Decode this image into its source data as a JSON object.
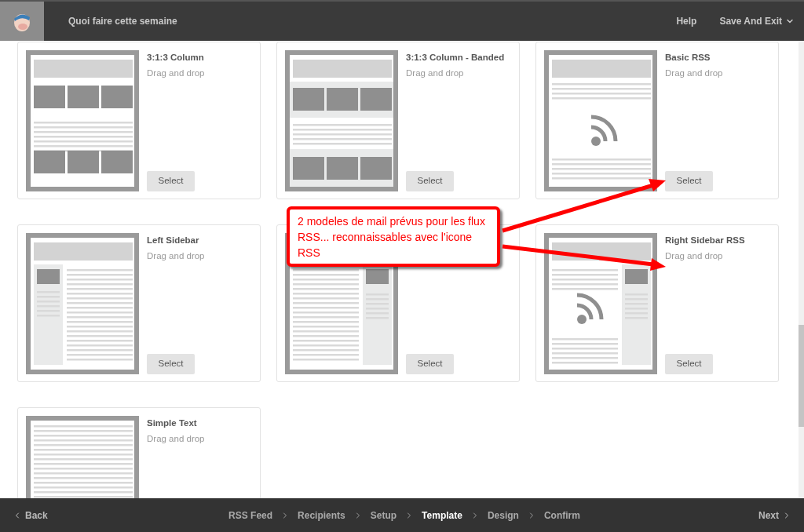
{
  "header": {
    "title": "Quoi faire cette semaine",
    "links": [
      {
        "label": "Help",
        "kind": "link"
      },
      {
        "label": "Save And Exit",
        "kind": "menu"
      }
    ]
  },
  "templates": [
    {
      "kind": "three-column",
      "title": "3:1:3 Column",
      "subtitle": "Drag and drop",
      "button": "Select"
    },
    {
      "kind": "three-column-banded",
      "title": "3:1:3 Column - Banded",
      "subtitle": "Drag and drop",
      "button": "Select"
    },
    {
      "kind": "basic-rss",
      "title": "Basic RSS",
      "subtitle": "Drag and drop",
      "button": "Select"
    },
    {
      "kind": "left-sidebar",
      "title": "Left Sidebar",
      "subtitle": "Drag and drop",
      "button": "Select"
    },
    {
      "kind": "right-sidebar",
      "button": "Select"
    },
    {
      "kind": "right-sidebar-rss",
      "title": "Right Sidebar RSS",
      "subtitle": "Drag and drop",
      "button": "Select"
    },
    {
      "kind": "simple-text",
      "title": "Simple Text",
      "subtitle": "Drag and drop"
    }
  ],
  "callout": {
    "text": "2 modeles de mail prévus pour les flux RSS... reconnaissables avec l'icone RSS"
  },
  "footer": {
    "back": "Back",
    "next": "Next",
    "steps": [
      {
        "label": "RSS Feed",
        "selected": false
      },
      {
        "label": "Recipients",
        "selected": false
      },
      {
        "label": "Setup",
        "selected": false
      },
      {
        "label": "Template",
        "selected": true
      },
      {
        "label": "Design",
        "selected": false
      },
      {
        "label": "Confirm",
        "selected": false
      }
    ]
  }
}
